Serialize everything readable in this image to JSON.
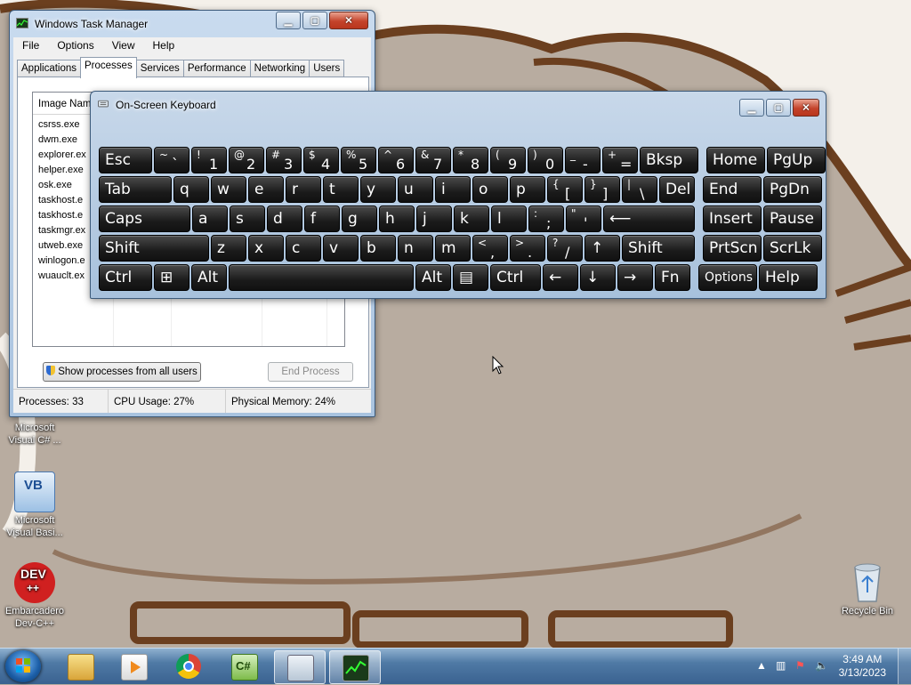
{
  "taskmanager": {
    "title": "Windows Task Manager",
    "menu": [
      "File",
      "Options",
      "View",
      "Help"
    ],
    "tabs": [
      "Applications",
      "Processes",
      "Services",
      "Performance",
      "Networking",
      "Users"
    ],
    "active_tab": "Processes",
    "column_header": "Image Nam",
    "processes": [
      "csrss.exe",
      "dwm.exe",
      "explorer.ex",
      "helper.exe",
      "osk.exe",
      "taskhost.e",
      "taskhost.e",
      "taskmgr.ex",
      "utweb.exe",
      "winlogon.e",
      "wuauclt.ex"
    ],
    "show_all_button": "Show processes from all users",
    "end_process_button": "End Process",
    "status": {
      "processes": "Processes: 33",
      "cpu": "CPU Usage: 27%",
      "memory": "Physical Memory: 24%"
    }
  },
  "osk": {
    "title": "On-Screen Keyboard",
    "rows": [
      [
        [
          "Esc"
        ],
        [
          "~",
          "`"
        ],
        [
          "!",
          "1"
        ],
        [
          "@",
          "2"
        ],
        [
          "#",
          "3"
        ],
        [
          "$",
          "4"
        ],
        [
          "%",
          "5"
        ],
        [
          "^",
          "6"
        ],
        [
          "&",
          "7"
        ],
        [
          "*",
          "8"
        ],
        [
          "(",
          "9"
        ],
        [
          ")",
          "0"
        ],
        [
          "_",
          "-"
        ],
        [
          "+",
          "="
        ],
        [
          "Bksp"
        ],
        [
          "Home"
        ],
        [
          "PgUp"
        ]
      ],
      [
        [
          "Tab"
        ],
        [
          "q"
        ],
        [
          "w"
        ],
        [
          "e"
        ],
        [
          "r"
        ],
        [
          "t"
        ],
        [
          "y"
        ],
        [
          "u"
        ],
        [
          "i"
        ],
        [
          "o"
        ],
        [
          "p"
        ],
        [
          "{",
          "["
        ],
        [
          "}",
          "]"
        ],
        [
          "|",
          "\\"
        ],
        [
          "Del"
        ],
        [
          "End"
        ],
        [
          "PgDn"
        ]
      ],
      [
        [
          "Caps"
        ],
        [
          "a"
        ],
        [
          "s"
        ],
        [
          "d"
        ],
        [
          "f"
        ],
        [
          "g"
        ],
        [
          "h"
        ],
        [
          "j"
        ],
        [
          "k"
        ],
        [
          "l"
        ],
        [
          ":",
          ";"
        ],
        [
          "\"",
          "'"
        ],
        [
          "⟵"
        ],
        [
          "Insert"
        ],
        [
          "Pause"
        ]
      ],
      [
        [
          "Shift"
        ],
        [
          "z"
        ],
        [
          "x"
        ],
        [
          "c"
        ],
        [
          "v"
        ],
        [
          "b"
        ],
        [
          "n"
        ],
        [
          "m"
        ],
        [
          "<",
          ","
        ],
        [
          ">",
          "."
        ],
        [
          "?",
          "/"
        ],
        [
          "↑"
        ],
        [
          "Shift"
        ],
        [
          "PrtScn"
        ],
        [
          "ScrLk"
        ]
      ],
      [
        [
          "Ctrl"
        ],
        [
          "⊞"
        ],
        [
          "Alt"
        ],
        [
          ""
        ],
        [
          "Alt"
        ],
        [
          "▤"
        ],
        [
          "Ctrl"
        ],
        [
          "←"
        ],
        [
          "↓"
        ],
        [
          "→"
        ],
        [
          "Fn"
        ],
        [
          "Options"
        ],
        [
          "Help"
        ]
      ]
    ]
  },
  "desktop_icons": [
    {
      "label_line1": "Microsoft",
      "label_line2": "Visual C# ...",
      "icon": "visual-csharp-icon"
    },
    {
      "label_line1": "Microsoft",
      "label_line2": "Visual Basi...",
      "icon": "visual-basic-icon"
    },
    {
      "label_line1": "Embarcadero",
      "label_line2": "Dev-C++",
      "icon": "dev-cpp-icon",
      "badge": "DEV",
      "badge2": "++"
    },
    {
      "label_line1": "Recycle Bin",
      "label_line2": "",
      "icon": "recycle-bin-icon"
    }
  ],
  "vb_badge": "VB",
  "taskbar": {
    "items": [
      "windows-explorer-icon",
      "media-player-icon",
      "chrome-icon",
      "csharp-express-icon",
      "on-screen-keyboard-icon",
      "task-manager-icon"
    ],
    "csharp_label": "C#",
    "time": "3:49 AM",
    "date": "3/13/2023"
  },
  "colors": {
    "wallpaper_bg": "#b8aca0",
    "wallpaper_stroke": "#6b3f1f",
    "wallpaper_white": "#f4f0ea",
    "taskbar": "#4f7aa5"
  }
}
